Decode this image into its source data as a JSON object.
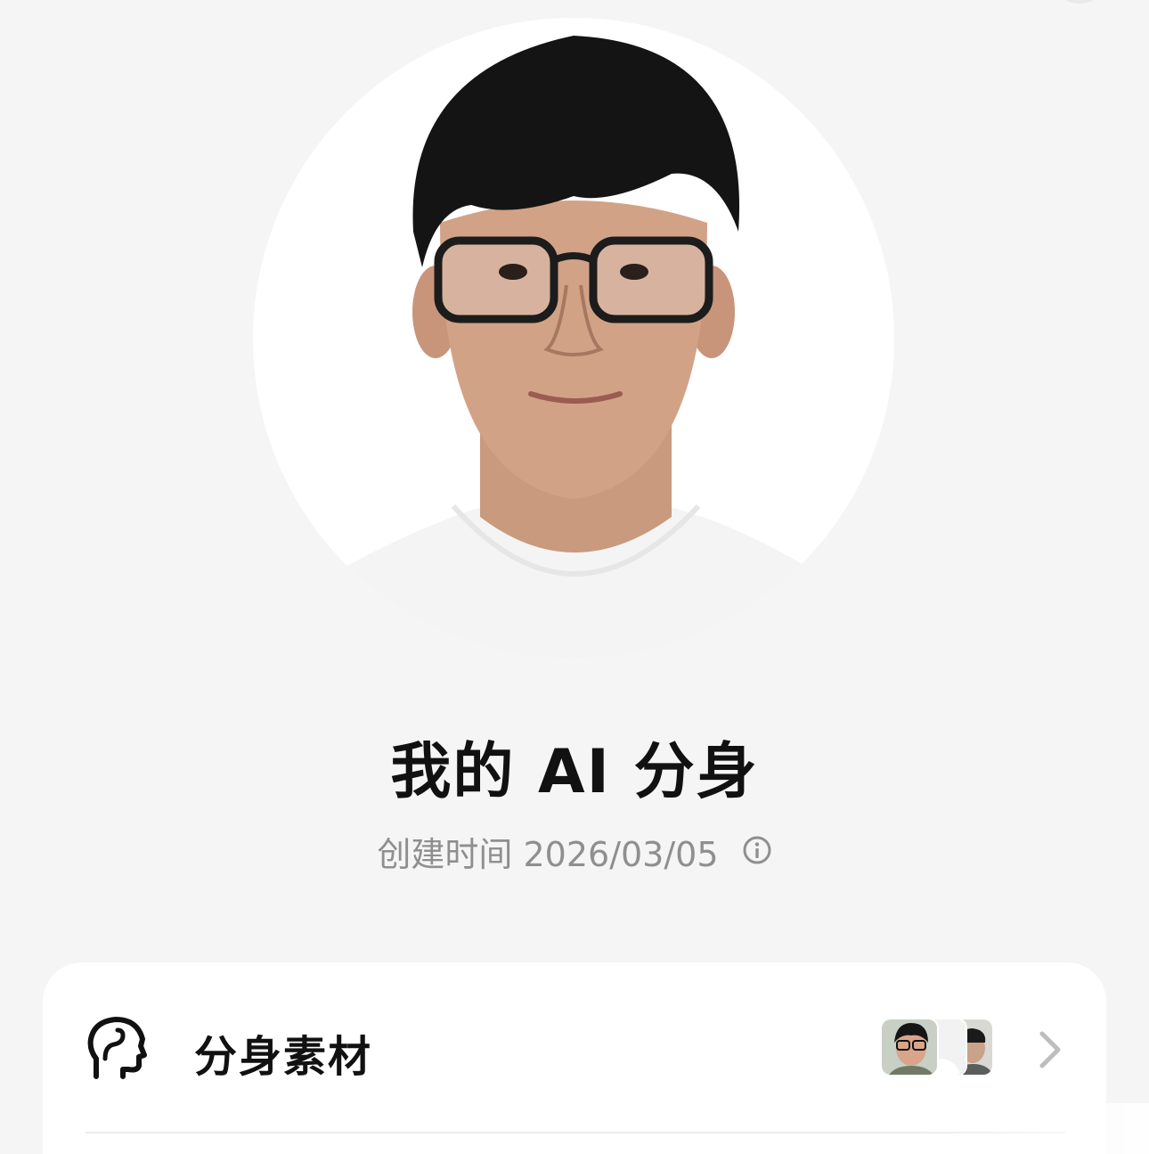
{
  "profile": {
    "title": "我的 AI 分身",
    "created_label": "创建时间",
    "created_date": "2026/03/05"
  },
  "icons": {
    "info": "info-circle-icon",
    "head": "head-profile-icon",
    "chevron": "chevron-right-icon"
  },
  "card": {
    "rows": [
      {
        "label": "分身素材"
      }
    ]
  },
  "colors": {
    "background": "#f5f5f5",
    "card": "#ffffff",
    "text_primary": "#111111",
    "text_secondary": "#8f8f8f"
  }
}
